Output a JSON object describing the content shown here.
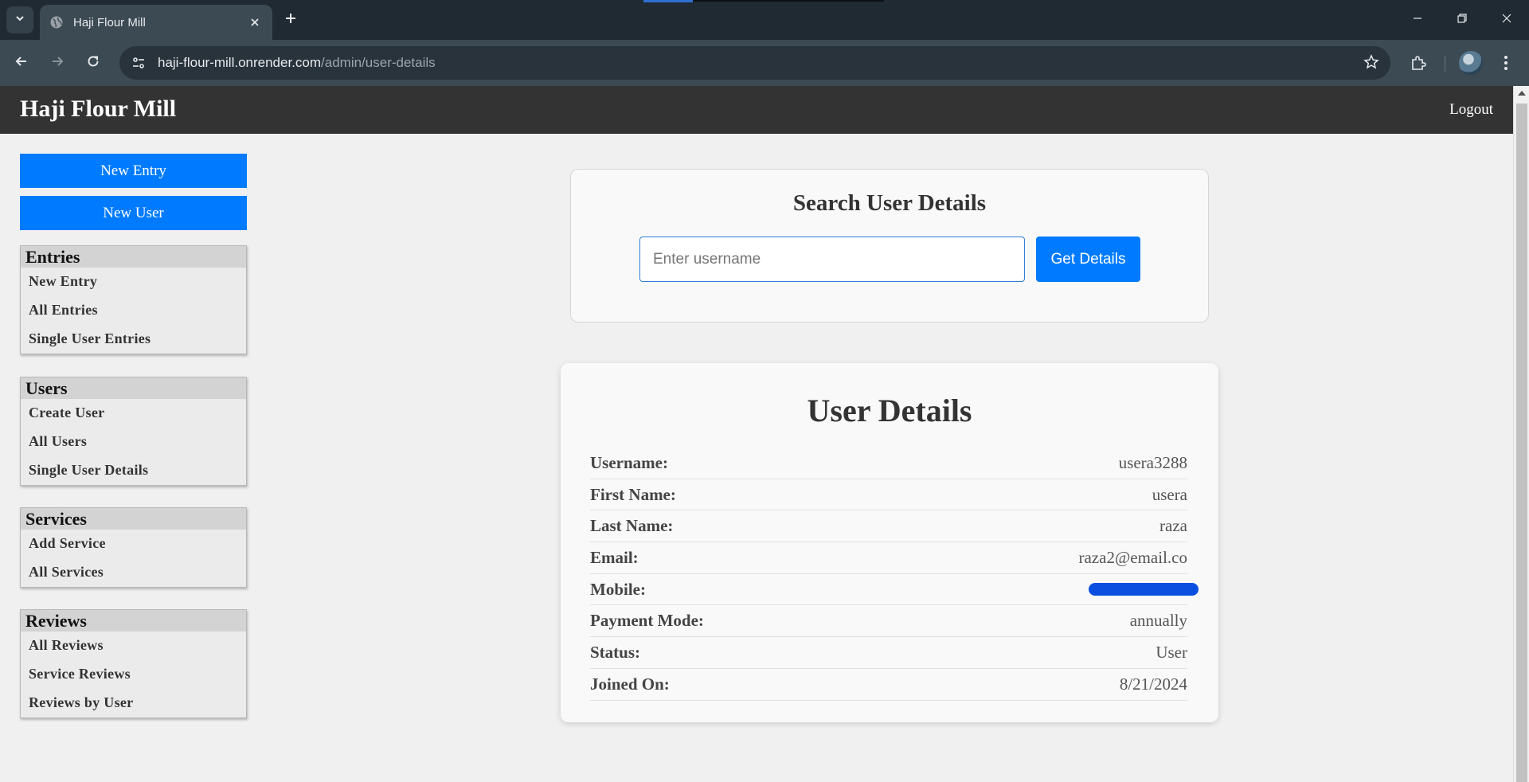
{
  "browser": {
    "tab_title": "Haji Flour Mill",
    "url_host": "haji-flour-mill.onrender.com",
    "url_path": "/admin/user-details"
  },
  "header": {
    "site_title": "Haji Flour Mill",
    "logout_label": "Logout"
  },
  "sidebar": {
    "buttons": [
      "New Entry",
      "New User"
    ],
    "sections": [
      {
        "heading": "Entries",
        "links": [
          "New Entry",
          "All Entries",
          "Single User Entries"
        ]
      },
      {
        "heading": "Users",
        "links": [
          "Create User",
          "All Users",
          "Single User Details"
        ]
      },
      {
        "heading": "Services",
        "links": [
          "Add Service",
          "All Services"
        ]
      },
      {
        "heading": "Reviews",
        "links": [
          "All Reviews",
          "Service Reviews",
          "Reviews by User"
        ]
      }
    ]
  },
  "search": {
    "title": "Search User Details",
    "placeholder": "Enter username",
    "value": "",
    "button_label": "Get Details"
  },
  "details": {
    "title": "User Details",
    "rows": [
      {
        "label": "Username:",
        "value": "usera3288"
      },
      {
        "label": "First Name:",
        "value": "usera"
      },
      {
        "label": "Last Name:",
        "value": "raza"
      },
      {
        "label": "Email:",
        "value": "raza2@email.co"
      },
      {
        "label": "Mobile:",
        "value": ""
      },
      {
        "label": "Payment Mode:",
        "value": "annually"
      },
      {
        "label": "Status:",
        "value": "User"
      },
      {
        "label": "Joined On:",
        "value": "8/21/2024"
      }
    ]
  },
  "colors": {
    "accent": "#007bff",
    "header_bg": "#333333",
    "page_bg": "#f0f0f0",
    "redaction": "#0b4fe0"
  }
}
